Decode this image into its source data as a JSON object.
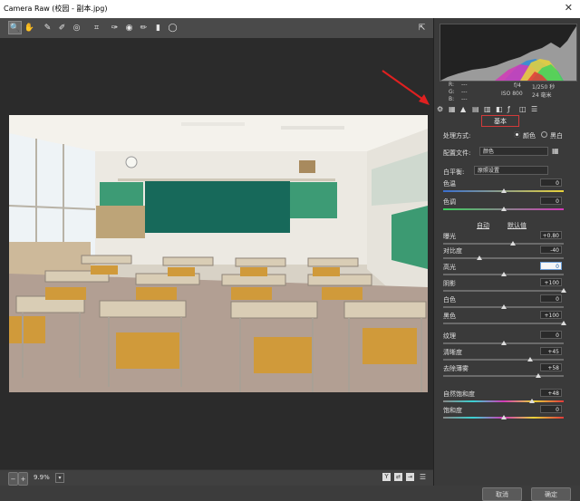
{
  "window": {
    "title": "Camera Raw (校园 - 副本.jpg)",
    "close_glyph": "✕"
  },
  "toolbar": {
    "tools": [
      {
        "name": "zoom-tool",
        "glyph": "🔍"
      },
      {
        "name": "hand-tool",
        "glyph": "✋"
      },
      {
        "name": "white-balance-tool",
        "glyph": "✎"
      },
      {
        "name": "color-sampler-tool",
        "glyph": "✐"
      },
      {
        "name": "targeted-adjustment-tool",
        "glyph": "◎"
      },
      {
        "name": "crop-tool",
        "glyph": "⌗"
      },
      {
        "name": "spot-removal-tool",
        "glyph": "✑"
      },
      {
        "name": "red-eye-tool",
        "glyph": "◉"
      },
      {
        "name": "adjustment-brush-tool",
        "glyph": "✏"
      },
      {
        "name": "graduated-filter-tool",
        "glyph": "▮"
      },
      {
        "name": "radial-filter-tool",
        "glyph": "◯"
      }
    ],
    "open_prefs_glyph": "⇱"
  },
  "status": {
    "zoom": "9.9%",
    "zoom_out": "−",
    "zoom_in": "+"
  },
  "bottom": {
    "cancel": "取消",
    "ok": "确定"
  },
  "camera": {
    "r": "R:",
    "g": "G:",
    "b": "B:",
    "dash": "---",
    "aperture": "f/4",
    "shutter": "1/250 秒",
    "iso": "ISO 800",
    "focal": "24 毫米"
  },
  "panel": {
    "title": "基本",
    "treatment_label": "处理方式:",
    "treatment_color": "颜色",
    "treatment_bw": "黑白",
    "profile_label": "配置文件:",
    "profile_value": "颜色",
    "wb_label": "白平衡:",
    "wb_value": "原照设置",
    "auto": "自动",
    "default": "默认值",
    "sliders": [
      {
        "label": "色温",
        "value": "0",
        "pos": 0.5
      },
      {
        "label": "色调",
        "value": "0",
        "pos": 0.5
      },
      {
        "label": "曝光",
        "value": "+0.80",
        "pos": 0.58
      },
      {
        "label": "对比度",
        "value": "-40",
        "pos": 0.3
      },
      {
        "label": "高光",
        "value": "0",
        "pos": 0.5,
        "focus": true
      },
      {
        "label": "阴影",
        "value": "+100",
        "pos": 1.0
      },
      {
        "label": "白色",
        "value": "0",
        "pos": 0.5
      },
      {
        "label": "黑色",
        "value": "+100",
        "pos": 1.0
      },
      {
        "label": "纹理",
        "value": "0",
        "pos": 0.5
      },
      {
        "label": "清晰度",
        "value": "+45",
        "pos": 0.72
      },
      {
        "label": "去除薄雾",
        "value": "+58",
        "pos": 0.79
      },
      {
        "label": "自然饱和度",
        "value": "+48",
        "pos": 0.74
      },
      {
        "label": "饱和度",
        "value": "0",
        "pos": 0.5
      }
    ]
  },
  "colors": {
    "accent_red": "#d23a3a",
    "panel_bg": "#3a3a3a"
  }
}
